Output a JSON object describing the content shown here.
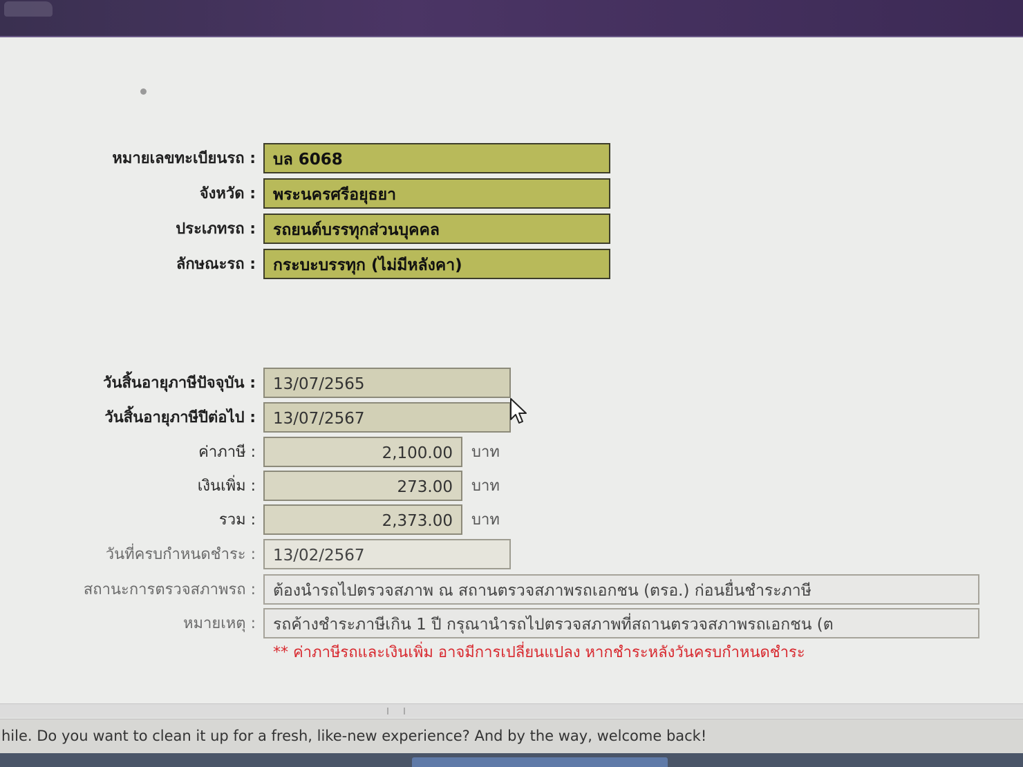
{
  "vehicle": {
    "plate_label": "หมายเลขทะเบียนรถ :",
    "plate_value": "บล 6068",
    "province_label": "จังหวัด :",
    "province_value": "พระนครศรีอยุธยา",
    "type_label": "ประเภทรถ :",
    "type_value": "รถยนต์บรรทุกส่วนบุคคล",
    "body_label": "ลักษณะรถ :",
    "body_value": "กระบะบรรทุก (ไม่มีหลังคา)"
  },
  "tax": {
    "current_expiry_label": "วันสิ้นอายุภาษีปัจจุบัน :",
    "current_expiry_value": "13/07/2565",
    "next_expiry_label": "วันสิ้นอายุภาษีปีต่อไป :",
    "next_expiry_value": "13/07/2567",
    "tax_label": "ค่าภาษี :",
    "tax_value": "2,100.00",
    "surcharge_label": "เงินเพิ่ม :",
    "surcharge_value": "273.00",
    "total_label": "รวม :",
    "total_value": "2,373.00",
    "currency": "บาท",
    "due_label": "วันที่ครบกำหนดชำระ :",
    "due_value": "13/02/2567",
    "inspection_label": "สถานะการตรวจสภาพรถ :",
    "inspection_value": "ต้องนำรถไปตรวจสภาพ ณ สถานตรวจสภาพรถเอกชน (ตรอ.) ก่อนยื่นชำระภาษี",
    "remark_label": "หมายเหตุ :",
    "remark_value": "รถค้างชำระภาษีเกิน 1 ปี กรุณานำรถไปตรวจสภาพที่สถานตรวจสภาพรถเอกชน (ต",
    "warning": "** ค่าภาษีรถและเงินเพิ่ม อาจมีการเปลี่ยนแปลง หากชำระหลังวันครบกำหนดชำระ"
  },
  "notification": {
    "text": "hile. Do you want to clean it up for a fresh, like-new experience? And by the way, welcome back!"
  },
  "icons": {
    "cursor": "mouse-pointer-icon",
    "logo": "car-logo-icon"
  }
}
